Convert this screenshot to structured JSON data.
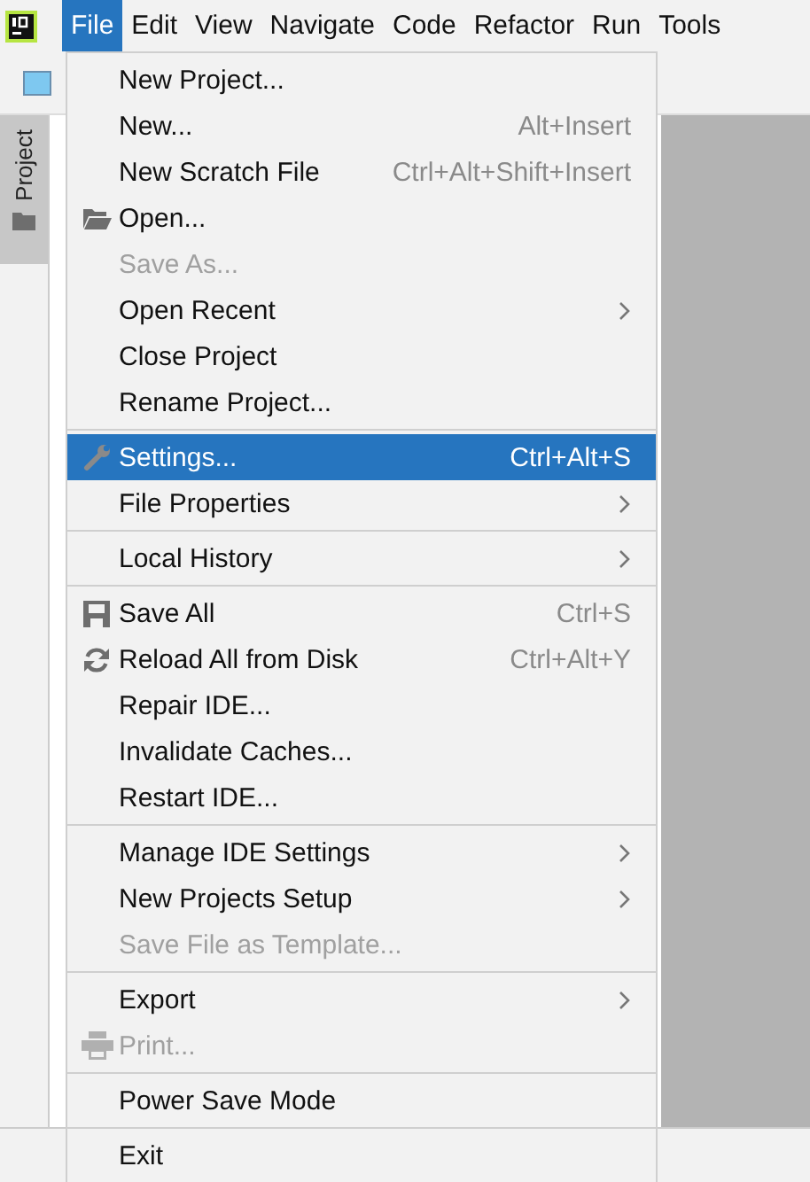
{
  "menu_bar": [
    {
      "label": "File",
      "selected": true
    },
    {
      "label": "Edit",
      "selected": false
    },
    {
      "label": "View",
      "selected": false
    },
    {
      "label": "Navigate",
      "selected": false
    },
    {
      "label": "Code",
      "selected": false
    },
    {
      "label": "Refactor",
      "selected": false
    },
    {
      "label": "Run",
      "selected": false
    },
    {
      "label": "Tools",
      "selected": false
    }
  ],
  "side_tab": {
    "label": "Project"
  },
  "file_menu": [
    [
      {
        "label": "New Project...",
        "disabled": false,
        "selected": false
      },
      {
        "label": "New...",
        "shortcut": "Alt+Insert",
        "disabled": false,
        "selected": false
      },
      {
        "label": "New Scratch File",
        "shortcut": "Ctrl+Alt+Shift+Insert",
        "disabled": false,
        "selected": false
      },
      {
        "label": "Open...",
        "kind": "folder",
        "disabled": false,
        "selected": false
      },
      {
        "label": "Save As...",
        "disabled": true,
        "selected": false
      },
      {
        "label": "Open Recent",
        "submenu": true,
        "disabled": false,
        "selected": false
      },
      {
        "label": "Close Project",
        "disabled": false,
        "selected": false
      },
      {
        "label": "Rename Project...",
        "disabled": false,
        "selected": false
      }
    ],
    [
      {
        "label": "Settings...",
        "shortcut": "Ctrl+Alt+S",
        "kind": "wrench",
        "disabled": false,
        "selected": true
      },
      {
        "label": "File Properties",
        "submenu": true,
        "disabled": false,
        "selected": false
      }
    ],
    [
      {
        "label": "Local History",
        "submenu": true,
        "disabled": false,
        "selected": false
      }
    ],
    [
      {
        "label": "Save All",
        "shortcut": "Ctrl+S",
        "kind": "floppy",
        "disabled": false,
        "selected": false
      },
      {
        "label": "Reload All from Disk",
        "shortcut": "Ctrl+Alt+Y",
        "kind": "reload",
        "disabled": false,
        "selected": false
      },
      {
        "label": "Repair IDE...",
        "disabled": false,
        "selected": false
      },
      {
        "label": "Invalidate Caches...",
        "disabled": false,
        "selected": false
      },
      {
        "label": "Restart IDE...",
        "disabled": false,
        "selected": false
      }
    ],
    [
      {
        "label": "Manage IDE Settings",
        "submenu": true,
        "disabled": false,
        "selected": false
      },
      {
        "label": "New Projects Setup",
        "submenu": true,
        "disabled": false,
        "selected": false
      },
      {
        "label": "Save File as Template...",
        "disabled": true,
        "selected": false
      }
    ],
    [
      {
        "label": "Export",
        "submenu": true,
        "disabled": false,
        "selected": false
      },
      {
        "label": "Print...",
        "kind": "printer",
        "disabled": true,
        "selected": false
      }
    ],
    [
      {
        "label": "Power Save Mode",
        "disabled": false,
        "selected": false
      }
    ],
    [
      {
        "label": "Exit",
        "disabled": false,
        "selected": false
      }
    ]
  ]
}
